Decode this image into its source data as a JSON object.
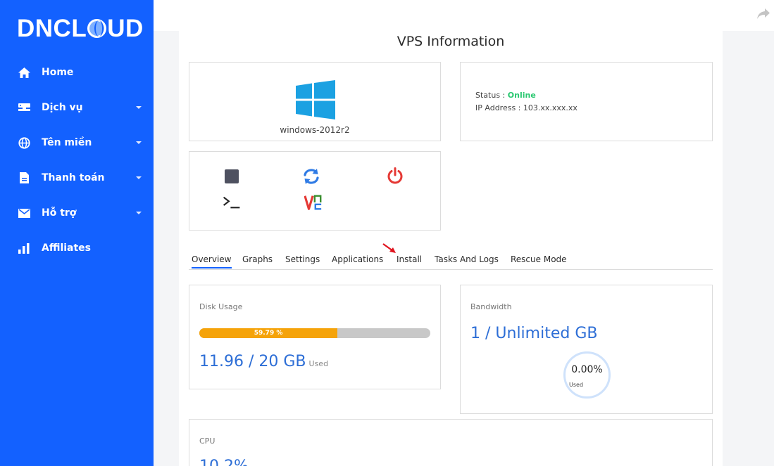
{
  "brand": {
    "logo_text_pre": "DNCL",
    "logo_text_post": "UD"
  },
  "sidebar": {
    "items": [
      {
        "label": "Home",
        "icon": "home-icon",
        "has_submenu": false
      },
      {
        "label": "Dịch vụ",
        "icon": "server-icon",
        "has_submenu": true
      },
      {
        "label": "Tên miền",
        "icon": "globe-icon",
        "has_submenu": true
      },
      {
        "label": "Thanh toán",
        "icon": "invoice-icon",
        "has_submenu": true
      },
      {
        "label": "Hỗ trợ",
        "icon": "envelope-icon",
        "has_submenu": true
      },
      {
        "label": "Affiliates",
        "icon": "bar-chart-icon",
        "has_submenu": false
      }
    ]
  },
  "page": {
    "title": "VPS Information"
  },
  "vps": {
    "os_name": "windows-2012r2",
    "status_label": "Status : ",
    "status_value": "Online",
    "ip_label": "IP Address : ",
    "ip_value": "103.xx.xxx.xx"
  },
  "actions": [
    {
      "name": "stop",
      "icon": "stop-icon"
    },
    {
      "name": "restart",
      "icon": "restart-icon"
    },
    {
      "name": "power",
      "icon": "power-icon"
    },
    {
      "name": "console",
      "icon": "terminal-icon"
    },
    {
      "name": "vnc",
      "icon": "vnc-icon"
    }
  ],
  "tabs": [
    "Overview",
    "Graphs",
    "Settings",
    "Applications",
    "Install",
    "Tasks And Logs",
    "Rescue Mode"
  ],
  "active_tab": "Overview",
  "disk": {
    "label": "Disk Usage",
    "percent": 59.79,
    "percent_text": "59.79 %",
    "value_text": "11.96 / 20 GB",
    "used_label": "Used"
  },
  "bandwidth": {
    "label": "Bandwidth",
    "value_text": "1 / Unlimited GB",
    "percent_text": "0.00%",
    "used_label": "Used"
  },
  "cpu": {
    "label": "CPU",
    "value_text": "10.2%"
  },
  "colors": {
    "sidebar": "#1361ff",
    "accent": "#2d6ed6",
    "online": "#28c76f",
    "disk_bar": "#f5a30a",
    "power": "#e53935",
    "restart": "#2f7be5"
  }
}
